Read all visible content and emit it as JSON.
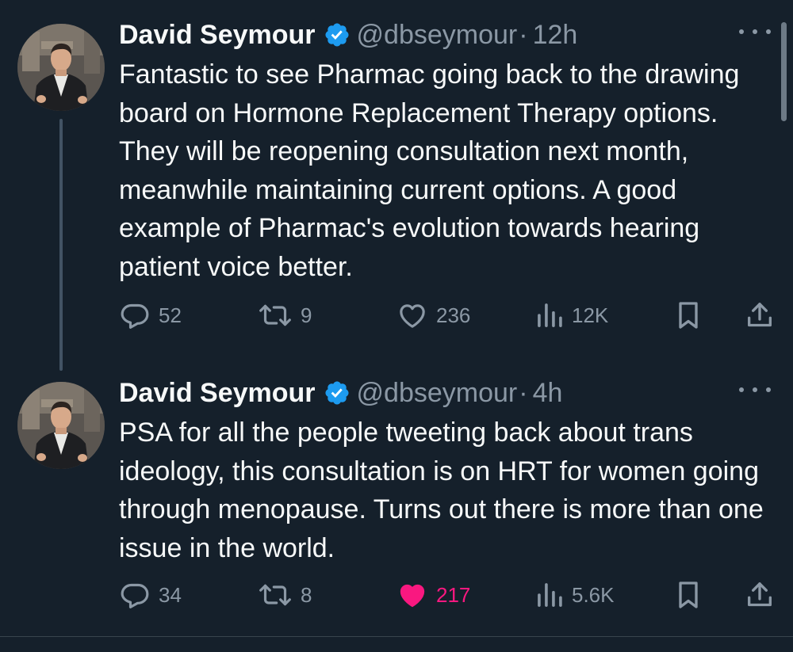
{
  "colors": {
    "background": "#15202b",
    "text": "#f7f9f9",
    "secondary": "#8b98a5",
    "verified": "#1d9bf0",
    "liked": "#f91880"
  },
  "tweets": [
    {
      "author_name": "David Seymour",
      "handle": "@dbseymour",
      "separator": "·",
      "time": "12h",
      "text": "Fantastic to see Pharmac going back to the drawing board on Hormone Replacement Therapy options. They will be reopening consultation next month, meanwhile maintaining current options. A good example of Pharmac's evolution towards hearing patient voice better.",
      "replies": "52",
      "retweets": "9",
      "likes": "236",
      "liked": false,
      "views": "12K"
    },
    {
      "author_name": "David Seymour",
      "handle": "@dbseymour",
      "separator": "·",
      "time": "4h",
      "text": "PSA for all the people tweeting back about trans ideology, this consultation is on HRT for women going through menopause. Turns out there is more than one issue in the world.",
      "replies": "34",
      "retweets": "8",
      "likes": "217",
      "liked": true,
      "views": "5.6K"
    }
  ],
  "icons": {
    "verified": "verified-badge-icon",
    "more": "more-options-icon",
    "reply": "reply-icon",
    "retweet": "retweet-icon",
    "like": "heart-icon",
    "views": "views-icon",
    "bookmark": "bookmark-icon",
    "share": "share-icon"
  }
}
